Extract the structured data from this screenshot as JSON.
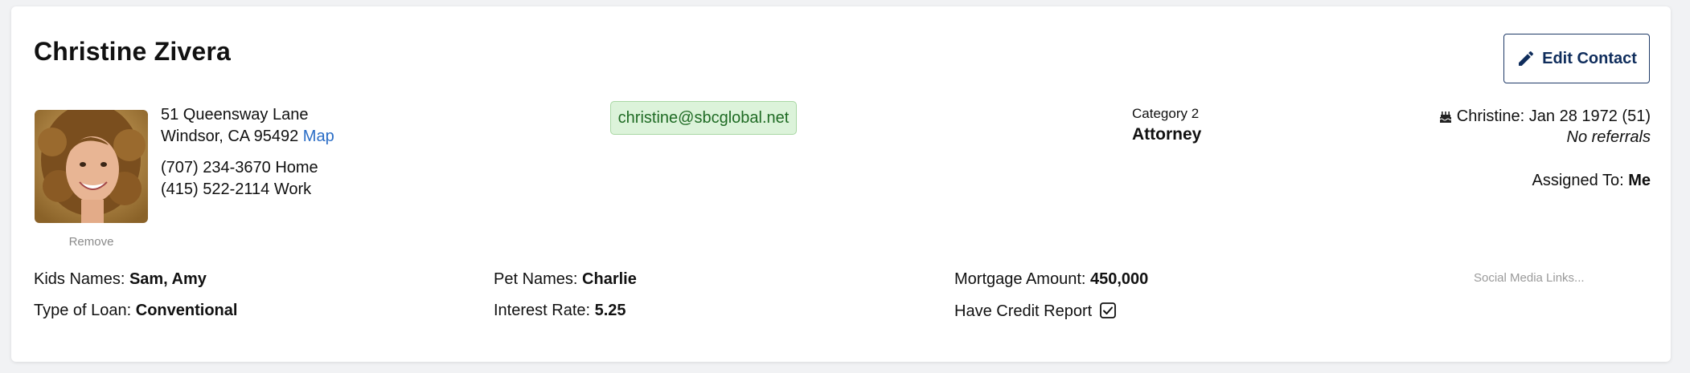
{
  "contact": {
    "name": "Christine Zivera",
    "edit_label": "Edit Contact",
    "remove_label": "Remove",
    "address_line1": "51 Queensway Lane",
    "address_line2": "Windsor, CA 95492",
    "map_label": "Map",
    "phone_home": "(707) 234-3670 Home",
    "phone_work": "(415) 522-2114 Work",
    "email": "christine@sbcglobal.net",
    "category_label": "Category 2",
    "category_value": "Attorney",
    "birthday": "Christine: Jan 28 1972 (51)",
    "referrals": "No referrals",
    "assigned_label": "Assigned To:",
    "assigned_value": "Me"
  },
  "fields": {
    "kids_label": "Kids Names:",
    "kids_value": "Sam, Amy",
    "pet_label": "Pet Names:",
    "pet_value": "Charlie",
    "mortgage_label": "Mortgage Amount:",
    "mortgage_value": "450,000",
    "loan_label": "Type of Loan:",
    "loan_value": "Conventional",
    "rate_label": "Interest Rate:",
    "rate_value": "5.25",
    "credit_label": "Have Credit Report",
    "credit_checked": true,
    "social_label": "Social Media Links..."
  },
  "icons": {
    "edit": "pencil-icon",
    "birthday": "cake-icon",
    "credit": "checkbox-checked-icon"
  },
  "colors": {
    "accent": "#0f2d5c",
    "link": "#2a6dc6",
    "email_bg": "#dcf3da",
    "email_text": "#1f6b24"
  }
}
